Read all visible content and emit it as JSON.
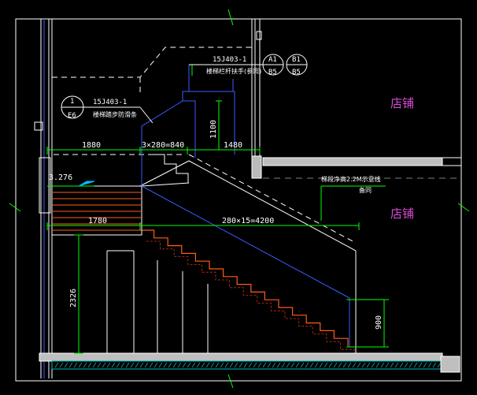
{
  "labels": {
    "shop_upper": "店铺",
    "shop_lower": "店铺",
    "dim_1880": "1880",
    "dim_3x280": "3×280=840",
    "dim_1480": "1480",
    "dim_1100": "1100",
    "dim_1780": "1780",
    "dim_280x15": "280×15=4200",
    "dim_2326": "2326",
    "dim_900": "900",
    "elev_3276": "3.276",
    "ref_top_code": "15J403-1",
    "ref_top_note": "楼梯栏杆扶手(参照)",
    "ref_top_a1": "A1",
    "ref_top_b5a": "B5",
    "ref_top_b1": "B1",
    "ref_top_b5b": "B5",
    "ref_left_code": "15J403-1",
    "ref_left_note": "楼梯踏步防滑条",
    "ref_left_1": "1",
    "ref_left_e6": "E6",
    "clear_note_1": "梯段净高2.2M示意线",
    "clear_note_2": "备同"
  },
  "colors": {
    "background": "#000000",
    "wall": "#ffffff",
    "dimension": "#00ff00",
    "railing": "#3b5bff",
    "stair": "#ff5a1a",
    "hatch": "#cc3311",
    "ground": "#00bbbb",
    "shop_text": "#d84bd8"
  }
}
